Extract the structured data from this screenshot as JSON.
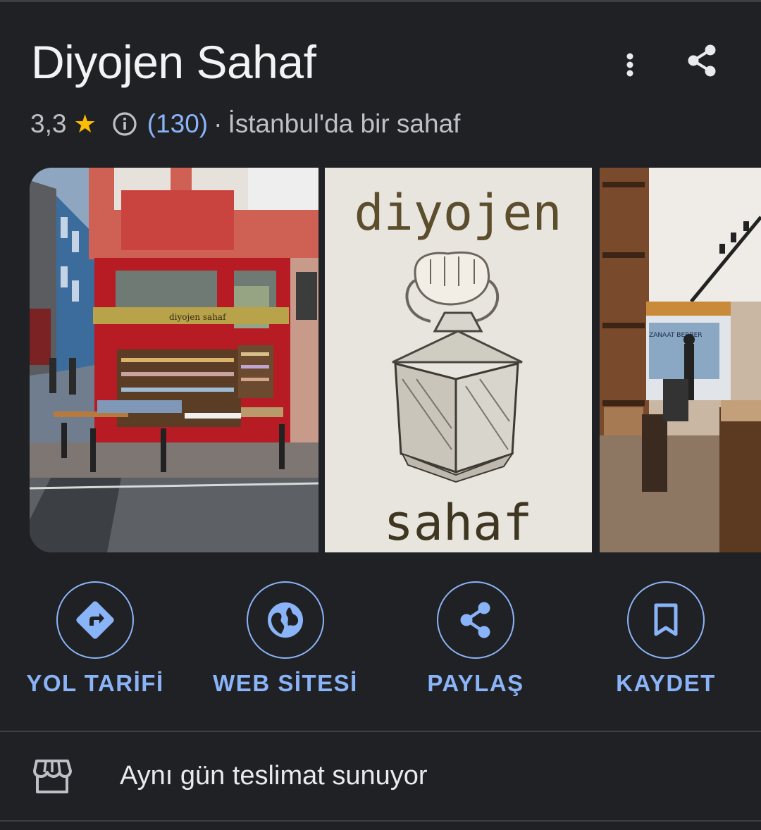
{
  "place": {
    "name": "Diyojen Sahaf",
    "rating": "3,3",
    "star_icon": "★",
    "reviews": "(130)",
    "separator": "·",
    "category": "İstanbul'da bir sahaf"
  },
  "photos": {
    "sign_top_text": "diyojen",
    "sign_bottom_text": "sahaf",
    "storefront_sign": "diyojen sahaf",
    "interior_sign": "ZANAAT BERBER"
  },
  "actions": [
    {
      "label": "YOL TARİFİ",
      "icon": "directions-icon"
    },
    {
      "label": "WEB SİTESİ",
      "icon": "globe-icon"
    },
    {
      "label": "PAYLAŞ",
      "icon": "share-icon"
    },
    {
      "label": "KAYDET",
      "icon": "bookmark-icon"
    }
  ],
  "attributes": {
    "delivery": "Aynı gün teslimat sunuyor"
  },
  "colors": {
    "background": "#202124",
    "accent": "#8ab4f8",
    "star": "#fbbc04"
  }
}
